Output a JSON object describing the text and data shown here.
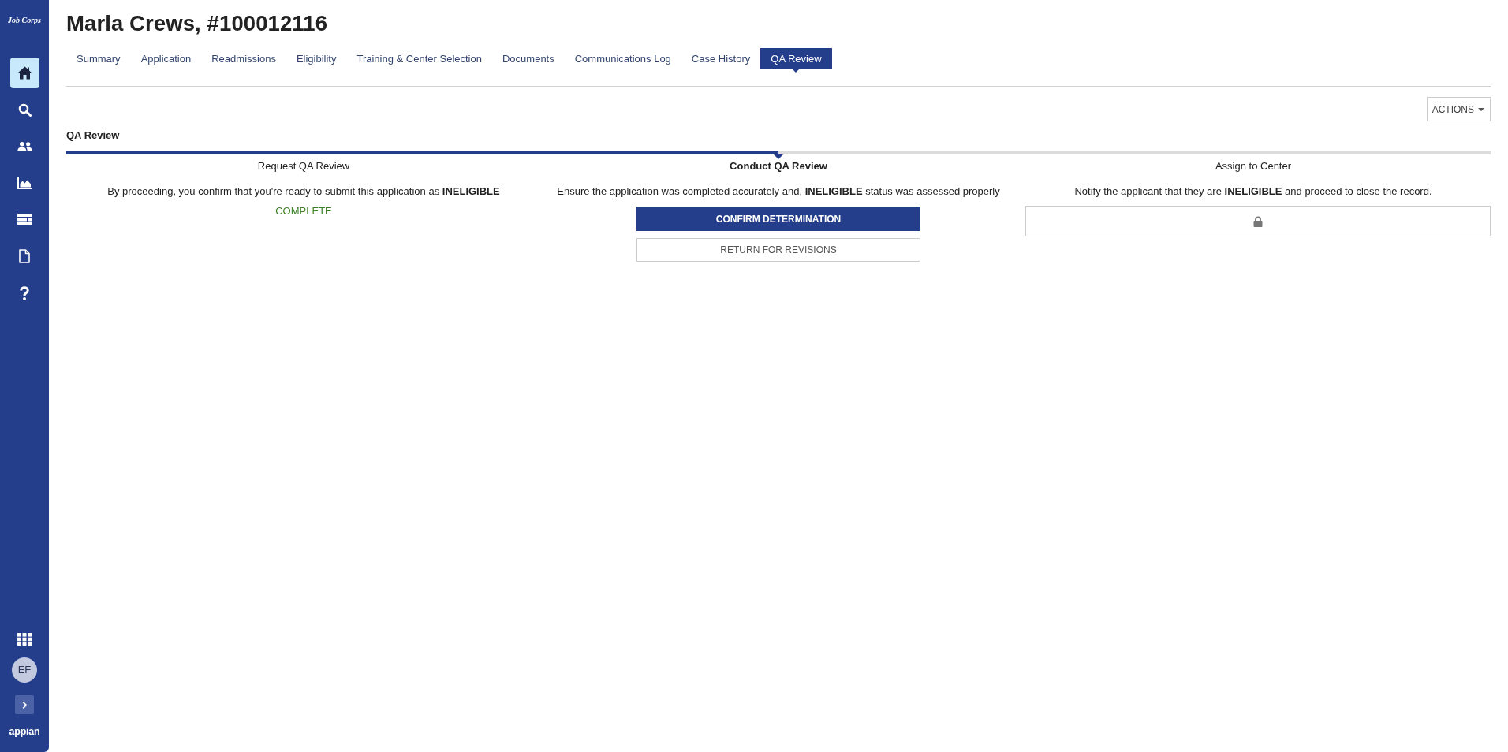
{
  "sidebar": {
    "logo": "Job Corps",
    "nav_items": [
      {
        "kind": "home",
        "selected": true
      },
      {
        "kind": "search",
        "selected": false
      },
      {
        "kind": "people",
        "selected": false
      },
      {
        "kind": "chart",
        "selected": false
      },
      {
        "kind": "list",
        "selected": false
      },
      {
        "kind": "document",
        "selected": false
      },
      {
        "kind": "help",
        "selected": false
      }
    ],
    "avatar": {
      "initials": "EF"
    },
    "brand": "appian"
  },
  "header": {
    "title": "Marla Crews, #100012116"
  },
  "tabs": [
    {
      "label": "Summary",
      "selected": false
    },
    {
      "label": "Application",
      "selected": false
    },
    {
      "label": "Readmissions",
      "selected": false
    },
    {
      "label": "Eligibility",
      "selected": false
    },
    {
      "label": "Training & Center Selection",
      "selected": false
    },
    {
      "label": "Documents",
      "selected": false
    },
    {
      "label": "Communications Log",
      "selected": false
    },
    {
      "label": "Case History",
      "selected": false
    },
    {
      "label": "QA Review",
      "selected": true
    }
  ],
  "actions_button": {
    "label": "ACTIONS"
  },
  "qa_review": {
    "title": "QA Review",
    "steps": [
      {
        "title": "Request QA Review",
        "completed": true,
        "current": false,
        "description": "By proceeding, you confirm that you're ready to submit this application as **INELIGIBLE**",
        "status_text": "COMPLETE"
      },
      {
        "title": "Conduct QA Review",
        "completed": false,
        "current": true,
        "description": "Ensure the application was completed accurately and, **INELIGIBLE** status was assessed properly",
        "buttons": [
          {
            "label": "CONFIRM DETERMINATION",
            "kind": "primary"
          },
          {
            "label": "RETURN FOR REVISIONS",
            "kind": "secondary"
          }
        ]
      },
      {
        "title": "Assign to Center",
        "completed": false,
        "current": false,
        "description": "Notify the applicant that they are **INELIGIBLE** and proceed to close the record.",
        "locked": true
      }
    ]
  }
}
